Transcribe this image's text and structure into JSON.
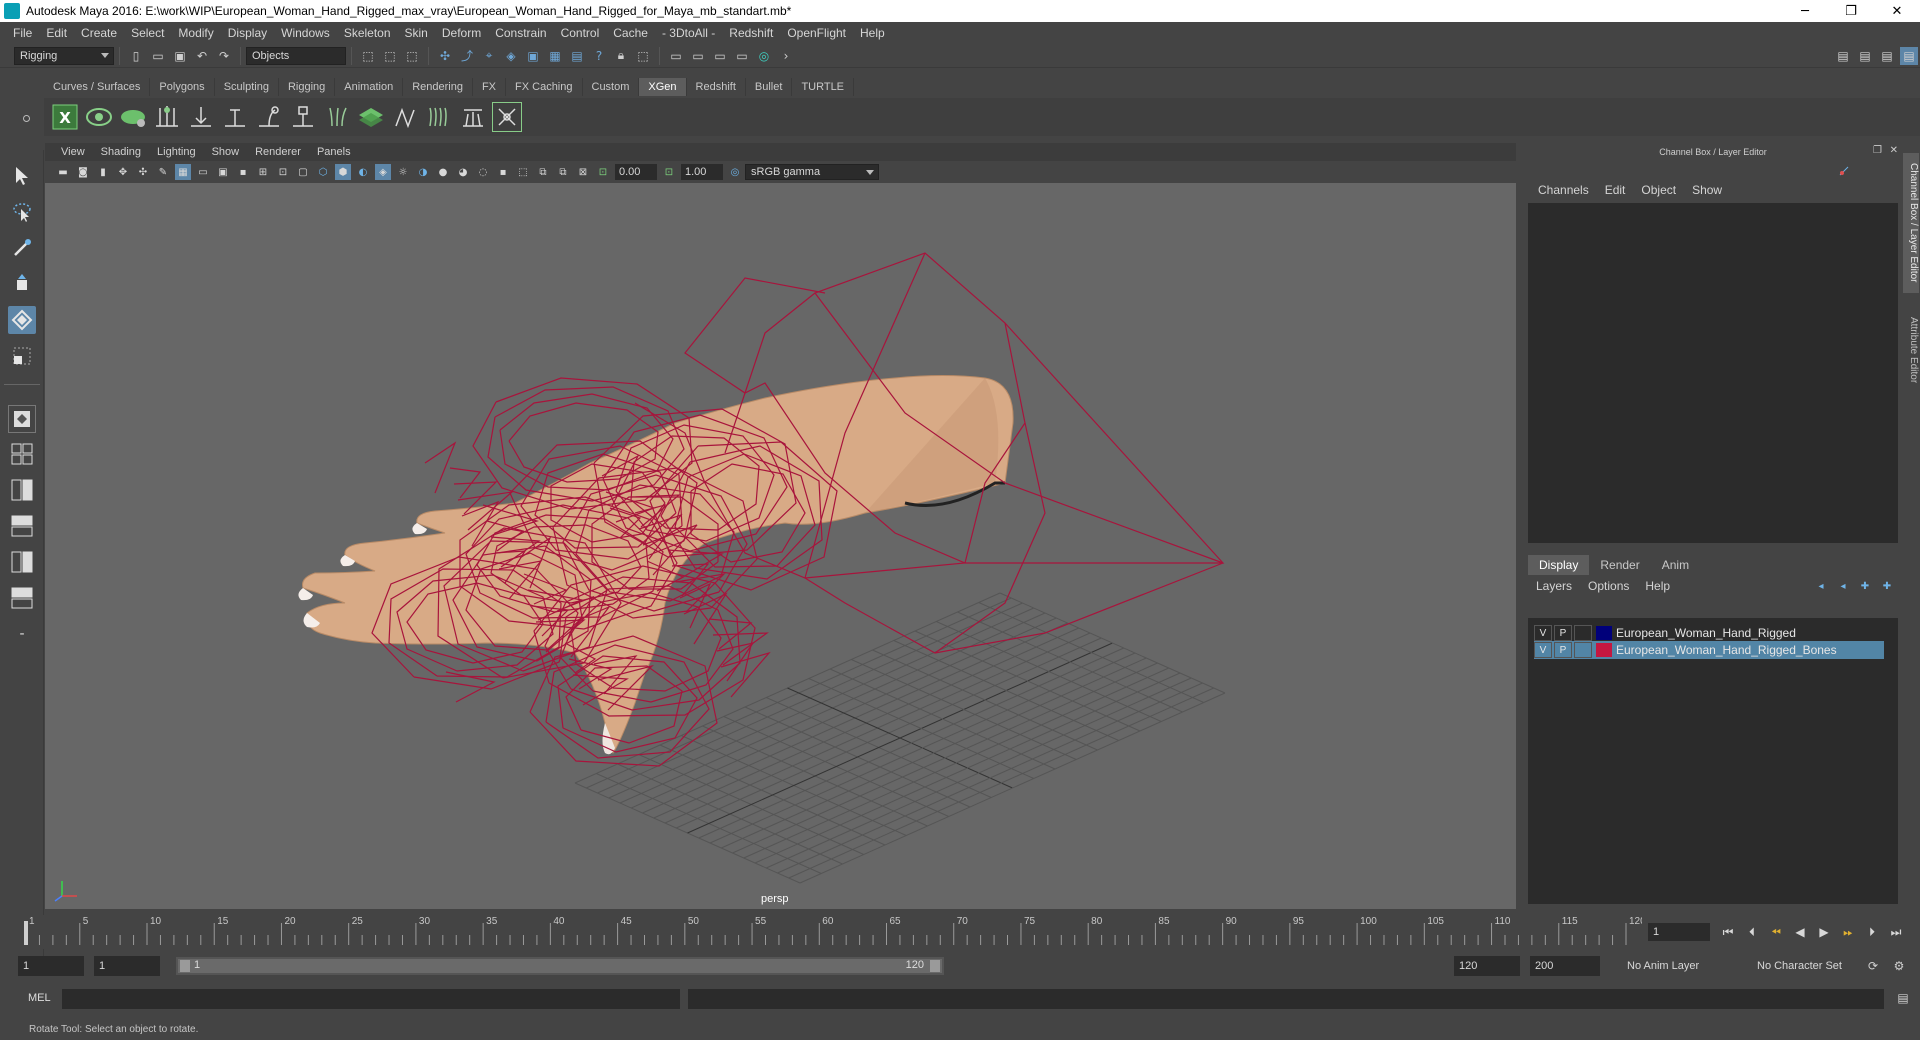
{
  "window": {
    "title": "Autodesk Maya 2016: E:\\work\\WIP\\European_Woman_Hand_Rigged_max_vray\\European_Woman_Hand_Rigged_for_Maya_mb_standart.mb*",
    "minimize": "─",
    "restore": "❐",
    "close": "✕"
  },
  "menubar": {
    "items": [
      "File",
      "Edit",
      "Create",
      "Select",
      "Modify",
      "Display",
      "Windows",
      "Skeleton",
      "Skin",
      "Deform",
      "Constrain",
      "Control",
      "Cache",
      "- 3DtoAll -",
      "Redshift",
      "OpenFlight",
      "Help"
    ]
  },
  "statusline": {
    "mode_value": "Rigging",
    "selection_mode_value": "Objects"
  },
  "shelf": {
    "tabs": [
      "Curves / Surfaces",
      "Polygons",
      "Sculpting",
      "Rigging",
      "Animation",
      "Rendering",
      "FX",
      "FX Caching",
      "Custom",
      "XGen",
      "Redshift",
      "Bullet",
      "TURTLE"
    ],
    "active_tab": "XGen"
  },
  "viewport": {
    "menu": [
      "View",
      "Shading",
      "Lighting",
      "Show",
      "Renderer",
      "Panels"
    ],
    "exposure_value": "0.00",
    "gamma_value": "1.00",
    "color_space_value": "sRGB gamma",
    "camera_label": "persp"
  },
  "right_panel": {
    "title": "Channel Box / Layer Editor",
    "channel_menu": [
      "Channels",
      "Edit",
      "Object",
      "Show"
    ],
    "layer_tabs": [
      "Display",
      "Render",
      "Anim"
    ],
    "active_layer_tab": "Display",
    "layer_menu": [
      "Layers",
      "Options",
      "Help"
    ],
    "layers": [
      {
        "v": "V",
        "p": "P",
        "name": "European_Woman_Hand_Rigged",
        "color": "#00007a",
        "selected": false
      },
      {
        "v": "V",
        "p": "P",
        "name": "European_Woman_Hand_Rigged_Bones",
        "color": "#c41740",
        "selected": true
      }
    ],
    "side_tabs": [
      "Channel Box / Layer Editor",
      "Attribute Editor"
    ]
  },
  "timeline": {
    "ticks": [
      "1",
      "5",
      "10",
      "15",
      "20",
      "25",
      "30",
      "35",
      "40",
      "45",
      "50",
      "55",
      "60",
      "65",
      "70",
      "75",
      "80",
      "85",
      "90",
      "95",
      "100",
      "105",
      "110",
      "115",
      "120"
    ],
    "current_frame": "1"
  },
  "range": {
    "start_time": "1",
    "playback_start": "1",
    "slider_start": "1",
    "slider_end": "120",
    "playback_end": "120",
    "end_time": "200",
    "anim_layer": "No Anim Layer",
    "character_set": "No Character Set"
  },
  "command_line": {
    "language_label": "MEL"
  },
  "help_line": {
    "text": "Rotate Tool: Select an object to rotate."
  },
  "colors": {
    "wireframe": "#a8143c",
    "skin": "#dcae8a",
    "accent": "#5285a6"
  }
}
